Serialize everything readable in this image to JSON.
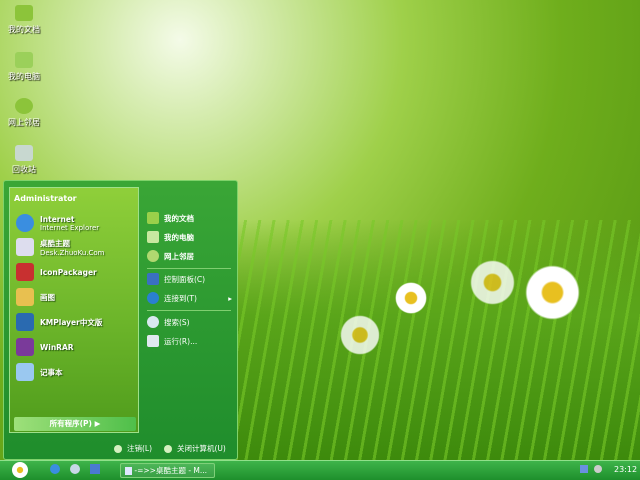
{
  "desktop": {
    "icons": [
      {
        "label": "我的文档",
        "icon": "folder-icon"
      },
      {
        "label": "我的电脑",
        "icon": "computer-icon"
      },
      {
        "label": "网上邻居",
        "icon": "network-icon"
      },
      {
        "label": "回收站",
        "icon": "recycle-bin-icon"
      }
    ]
  },
  "start_menu": {
    "user": "Administrator",
    "left_items": [
      {
        "title": "Internet",
        "subtitle": "Internet Explorer",
        "icon": "ie-icon"
      },
      {
        "title": "桌酷主题",
        "subtitle": "Desk.ZhuoKu.Com",
        "icon": "zhuoku-icon"
      },
      {
        "title": "IconPackager",
        "icon": "iconpackager-icon"
      },
      {
        "title": "画图",
        "icon": "paint-icon"
      },
      {
        "title": "KMPlayer中文版",
        "icon": "kmplayer-icon"
      },
      {
        "title": "WinRAR",
        "icon": "winrar-icon"
      },
      {
        "title": "记事本",
        "icon": "notepad-icon"
      }
    ],
    "all_programs": "所有程序(P)",
    "right_items": [
      {
        "label": "我的文档",
        "icon": "folder-icon",
        "bold": true
      },
      {
        "label": "我的电脑",
        "icon": "computer-icon",
        "bold": true
      },
      {
        "label": "网上邻居",
        "icon": "network-icon",
        "bold": true
      },
      {
        "label": "控制面板(C)",
        "icon": "control-panel-icon"
      },
      {
        "label": "连接到(T)",
        "icon": "connect-icon"
      },
      {
        "label": "搜索(S)",
        "icon": "search-icon"
      },
      {
        "label": "运行(R)...",
        "icon": "run-icon"
      }
    ],
    "logoff": "注销(L)",
    "shutdown": "关闭计算机(U)"
  },
  "taskbar": {
    "task": "-=>>桌酷主题 - M...",
    "clock": "23:12"
  },
  "colors": {
    "menu": "#2a9a32",
    "taskbar": "#2aa03a"
  }
}
